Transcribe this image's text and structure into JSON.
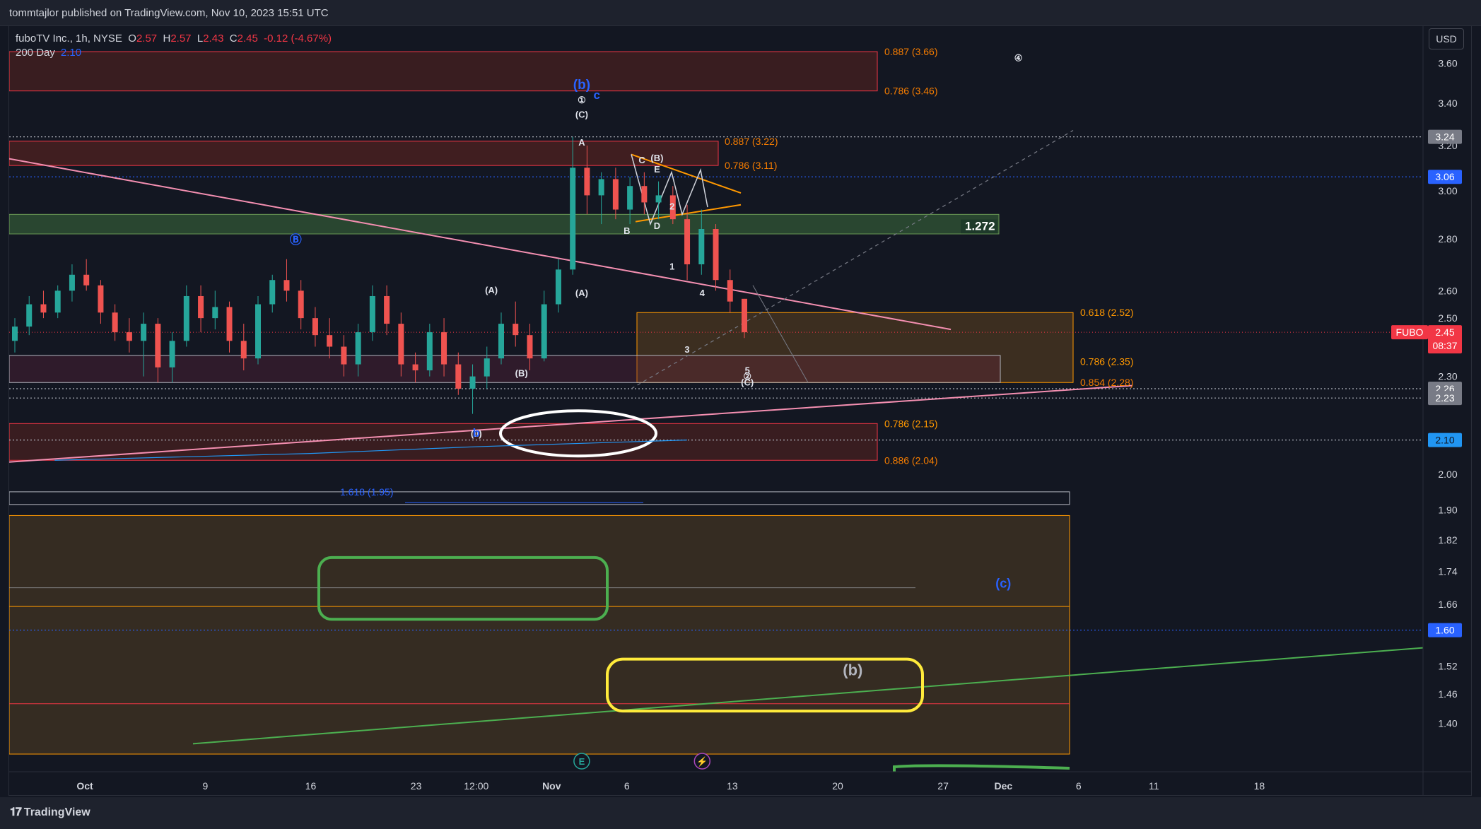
{
  "publisher": "tommtajlor published on TradingView.com, Nov 10, 2023 15:51 UTC",
  "legend": {
    "symbol": "fuboTV Inc., 1h, NYSE",
    "open_label": "O",
    "open": "2.57",
    "high_label": "H",
    "high": "2.57",
    "low_label": "L",
    "low": "2.43",
    "close_label": "C",
    "close": "2.45",
    "change": "-0.12 (-4.67%)",
    "ma_label": "200 Day",
    "ma_value": "2.10"
  },
  "currency_button": "USD",
  "brand": "TradingView",
  "colors": {
    "background": "#131722",
    "bull": "#26a69a",
    "bear": "#ef5350",
    "trendline": "#f48fb1",
    "triangle": "#ff9800",
    "fib_text": "#ff6d00",
    "wave_blue": "#2962ff",
    "green_box": "#4caf50",
    "yellow_box": "#ffeb3b"
  },
  "chart_data": {
    "type": "candlestick",
    "symbol": "FUBO",
    "interval": "1h",
    "y_scale": "log",
    "ylim": [
      1.34,
      3.72
    ],
    "x_ticks": [
      "Oct",
      "9",
      "16",
      "23",
      "12:00",
      "Nov",
      "6",
      "13",
      "20",
      "27",
      "Dec",
      "6",
      "11",
      "18"
    ],
    "y_ticks": [
      "3.60",
      "3.40",
      "3.20",
      "3.00",
      "2.80",
      "2.60",
      "2.50",
      "2.30",
      "2.00",
      "1.90",
      "1.82",
      "1.74",
      "1.66",
      "1.52",
      "1.46",
      "1.40"
    ],
    "price_badges": [
      {
        "value": "3.24",
        "style": "grey"
      },
      {
        "value": "3.06",
        "style": "blue"
      },
      {
        "value": "2.26",
        "style": "grey"
      },
      {
        "value": "2.23",
        "style": "grey"
      },
      {
        "value": "2.10",
        "style": "ma"
      },
      {
        "value": "1.60",
        "style": "blue"
      }
    ],
    "last_price": {
      "symbol": "FUBO",
      "value": "2.45",
      "countdown": "08:37"
    },
    "fib_labels": [
      {
        "text": "0.887 (3.66)",
        "price": 3.66
      },
      {
        "text": "0.786 (3.46)",
        "price": 3.46
      },
      {
        "text": "0.887 (3.22)",
        "price": 3.22
      },
      {
        "text": "0.786 (3.11)",
        "price": 3.11
      },
      {
        "text": "1.272",
        "price": 2.85
      },
      {
        "text": "0.618 (2.52)",
        "price": 2.52
      },
      {
        "text": "0.786 (2.35)",
        "price": 2.35
      },
      {
        "text": "0.854 (2.28)",
        "price": 2.28
      },
      {
        "text": "0.786 (2.15)",
        "price": 2.15
      },
      {
        "text": "0.886 (2.04)",
        "price": 2.04
      },
      {
        "text": "1.618 (1.95)",
        "price": 1.95
      }
    ],
    "wave_labels": [
      {
        "text": "①",
        "date": "Nov 3",
        "price": 3.4
      },
      {
        "text": "(C)",
        "date": "Nov 3",
        "price": 3.33
      },
      {
        "text": "(b)",
        "date": "Nov 3",
        "price": 3.47
      },
      {
        "text": "c",
        "date": "Nov 4",
        "price": 3.42
      },
      {
        "text": "A",
        "date": "Nov 3",
        "price": 3.2
      },
      {
        "text": "B",
        "date": "Nov 6",
        "price": 2.82
      },
      {
        "text": "C",
        "date": "Nov 7",
        "price": 3.12
      },
      {
        "text": "D",
        "date": "Nov 8",
        "price": 2.84
      },
      {
        "text": "E",
        "date": "Nov 8",
        "price": 3.08
      },
      {
        "text": "(B)",
        "date": "Nov 8",
        "price": 3.13
      },
      {
        "text": "2",
        "date": "Nov 9",
        "price": 2.92
      },
      {
        "text": "1",
        "date": "Nov 9",
        "price": 2.68
      },
      {
        "text": "3",
        "date": "Nov 10",
        "price": 2.38
      },
      {
        "text": "4",
        "date": "Nov 11",
        "price": 2.58
      },
      {
        "text": "5",
        "date": "Nov 14",
        "price": 2.31
      },
      {
        "text": "②",
        "date": "Nov 14",
        "price": 2.29
      },
      {
        "text": "(C)",
        "date": "Nov 14",
        "price": 2.27
      },
      {
        "text": "(A)",
        "date": "Oct 28",
        "price": 2.59
      },
      {
        "text": "(A)",
        "date": "Nov 3",
        "price": 2.58
      },
      {
        "text": "(B)",
        "date": "Oct 30",
        "price": 2.3
      },
      {
        "text": "Ⓑ",
        "date": "Oct 15",
        "price": 2.78
      },
      {
        "text": "(ii)",
        "date": "Oct 27",
        "price": 2.11
      },
      {
        "text": "b",
        "date": "Oct 27",
        "price": 2.11
      },
      {
        "text": "④",
        "date": "Dec 2",
        "price": 3.61
      },
      {
        "text": "(c)",
        "date": "Dec 1",
        "price": 1.7
      },
      {
        "text": "(b)",
        "date": "Nov 21",
        "price": 1.5
      }
    ],
    "event_markers": [
      {
        "text": "E",
        "date": "Nov 3"
      },
      {
        "text": "⚡",
        "date": "Nov 11"
      }
    ],
    "ma200": [
      {
        "date": "Sep 29",
        "value": 2.04
      },
      {
        "date": "Oct 16",
        "value": 2.06
      },
      {
        "date": "Oct 27",
        "value": 2.08
      },
      {
        "date": "Nov 3",
        "value": 2.09
      },
      {
        "date": "Nov 10",
        "value": 2.1
      }
    ],
    "candles": [
      {
        "t": 0,
        "o": 2.42,
        "h": 2.5,
        "l": 2.38,
        "c": 2.47
      },
      {
        "t": 1,
        "o": 2.47,
        "h": 2.58,
        "l": 2.44,
        "c": 2.55
      },
      {
        "t": 2,
        "o": 2.55,
        "h": 2.6,
        "l": 2.5,
        "c": 2.52
      },
      {
        "t": 3,
        "o": 2.52,
        "h": 2.62,
        "l": 2.5,
        "c": 2.6
      },
      {
        "t": 4,
        "o": 2.6,
        "h": 2.7,
        "l": 2.56,
        "c": 2.66
      },
      {
        "t": 5,
        "o": 2.66,
        "h": 2.72,
        "l": 2.6,
        "c": 2.62
      },
      {
        "t": 6,
        "o": 2.62,
        "h": 2.64,
        "l": 2.48,
        "c": 2.52
      },
      {
        "t": 7,
        "o": 2.52,
        "h": 2.55,
        "l": 2.42,
        "c": 2.45
      },
      {
        "t": 8,
        "o": 2.45,
        "h": 2.5,
        "l": 2.38,
        "c": 2.42
      },
      {
        "t": 9,
        "o": 2.42,
        "h": 2.52,
        "l": 2.3,
        "c": 2.48
      },
      {
        "t": 10,
        "o": 2.48,
        "h": 2.5,
        "l": 2.28,
        "c": 2.33
      },
      {
        "t": 11,
        "o": 2.33,
        "h": 2.45,
        "l": 2.28,
        "c": 2.42
      },
      {
        "t": 12,
        "o": 2.42,
        "h": 2.62,
        "l": 2.4,
        "c": 2.58
      },
      {
        "t": 13,
        "o": 2.58,
        "h": 2.62,
        "l": 2.45,
        "c": 2.5
      },
      {
        "t": 14,
        "o": 2.5,
        "h": 2.6,
        "l": 2.46,
        "c": 2.54
      },
      {
        "t": 15,
        "o": 2.54,
        "h": 2.56,
        "l": 2.38,
        "c": 2.42
      },
      {
        "t": 16,
        "o": 2.42,
        "h": 2.48,
        "l": 2.32,
        "c": 2.36
      },
      {
        "t": 17,
        "o": 2.36,
        "h": 2.58,
        "l": 2.34,
        "c": 2.55
      },
      {
        "t": 18,
        "o": 2.55,
        "h": 2.66,
        "l": 2.52,
        "c": 2.64
      },
      {
        "t": 19,
        "o": 2.64,
        "h": 2.72,
        "l": 2.56,
        "c": 2.6
      },
      {
        "t": 20,
        "o": 2.6,
        "h": 2.64,
        "l": 2.46,
        "c": 2.5
      },
      {
        "t": 21,
        "o": 2.5,
        "h": 2.54,
        "l": 2.4,
        "c": 2.44
      },
      {
        "t": 22,
        "o": 2.44,
        "h": 2.5,
        "l": 2.36,
        "c": 2.4
      },
      {
        "t": 23,
        "o": 2.4,
        "h": 2.44,
        "l": 2.3,
        "c": 2.34
      },
      {
        "t": 24,
        "o": 2.34,
        "h": 2.48,
        "l": 2.3,
        "c": 2.45
      },
      {
        "t": 25,
        "o": 2.45,
        "h": 2.62,
        "l": 2.42,
        "c": 2.58
      },
      {
        "t": 26,
        "o": 2.58,
        "h": 2.62,
        "l": 2.44,
        "c": 2.48
      },
      {
        "t": 27,
        "o": 2.48,
        "h": 2.52,
        "l": 2.3,
        "c": 2.34
      },
      {
        "t": 28,
        "o": 2.34,
        "h": 2.38,
        "l": 2.28,
        "c": 2.32
      },
      {
        "t": 29,
        "o": 2.32,
        "h": 2.48,
        "l": 2.3,
        "c": 2.45
      },
      {
        "t": 30,
        "o": 2.45,
        "h": 2.5,
        "l": 2.3,
        "c": 2.34
      },
      {
        "t": 31,
        "o": 2.34,
        "h": 2.38,
        "l": 2.24,
        "c": 2.26
      },
      {
        "t": 32,
        "o": 2.26,
        "h": 2.34,
        "l": 2.18,
        "c": 2.3
      },
      {
        "t": 33,
        "o": 2.3,
        "h": 2.4,
        "l": 2.26,
        "c": 2.36
      },
      {
        "t": 34,
        "o": 2.36,
        "h": 2.52,
        "l": 2.34,
        "c": 2.48
      },
      {
        "t": 35,
        "o": 2.48,
        "h": 2.56,
        "l": 2.4,
        "c": 2.44
      },
      {
        "t": 36,
        "o": 2.44,
        "h": 2.48,
        "l": 2.32,
        "c": 2.36
      },
      {
        "t": 37,
        "o": 2.36,
        "h": 2.6,
        "l": 2.35,
        "c": 2.55
      },
      {
        "t": 38,
        "o": 2.55,
        "h": 2.72,
        "l": 2.52,
        "c": 2.68
      },
      {
        "t": 39,
        "o": 2.68,
        "h": 3.24,
        "l": 2.66,
        "c": 3.1
      },
      {
        "t": 40,
        "o": 3.1,
        "h": 3.2,
        "l": 2.9,
        "c": 2.98
      },
      {
        "t": 41,
        "o": 2.98,
        "h": 3.08,
        "l": 2.86,
        "c": 3.05
      },
      {
        "t": 42,
        "o": 3.05,
        "h": 3.1,
        "l": 2.88,
        "c": 2.92
      },
      {
        "t": 43,
        "o": 2.92,
        "h": 3.06,
        "l": 2.86,
        "c": 3.02
      },
      {
        "t": 44,
        "o": 3.02,
        "h": 3.08,
        "l": 2.9,
        "c": 2.95
      },
      {
        "t": 45,
        "o": 2.95,
        "h": 3.04,
        "l": 2.88,
        "c": 2.98
      },
      {
        "t": 46,
        "o": 2.98,
        "h": 3.02,
        "l": 2.86,
        "c": 2.88
      },
      {
        "t": 47,
        "o": 2.88,
        "h": 2.94,
        "l": 2.64,
        "c": 2.7
      },
      {
        "t": 48,
        "o": 2.7,
        "h": 2.92,
        "l": 2.66,
        "c": 2.84
      },
      {
        "t": 49,
        "o": 2.84,
        "h": 2.86,
        "l": 2.6,
        "c": 2.64
      },
      {
        "t": 50,
        "o": 2.64,
        "h": 2.68,
        "l": 2.52,
        "c": 2.56
      },
      {
        "t": 51,
        "o": 2.57,
        "h": 2.57,
        "l": 2.43,
        "c": 2.45
      }
    ]
  }
}
